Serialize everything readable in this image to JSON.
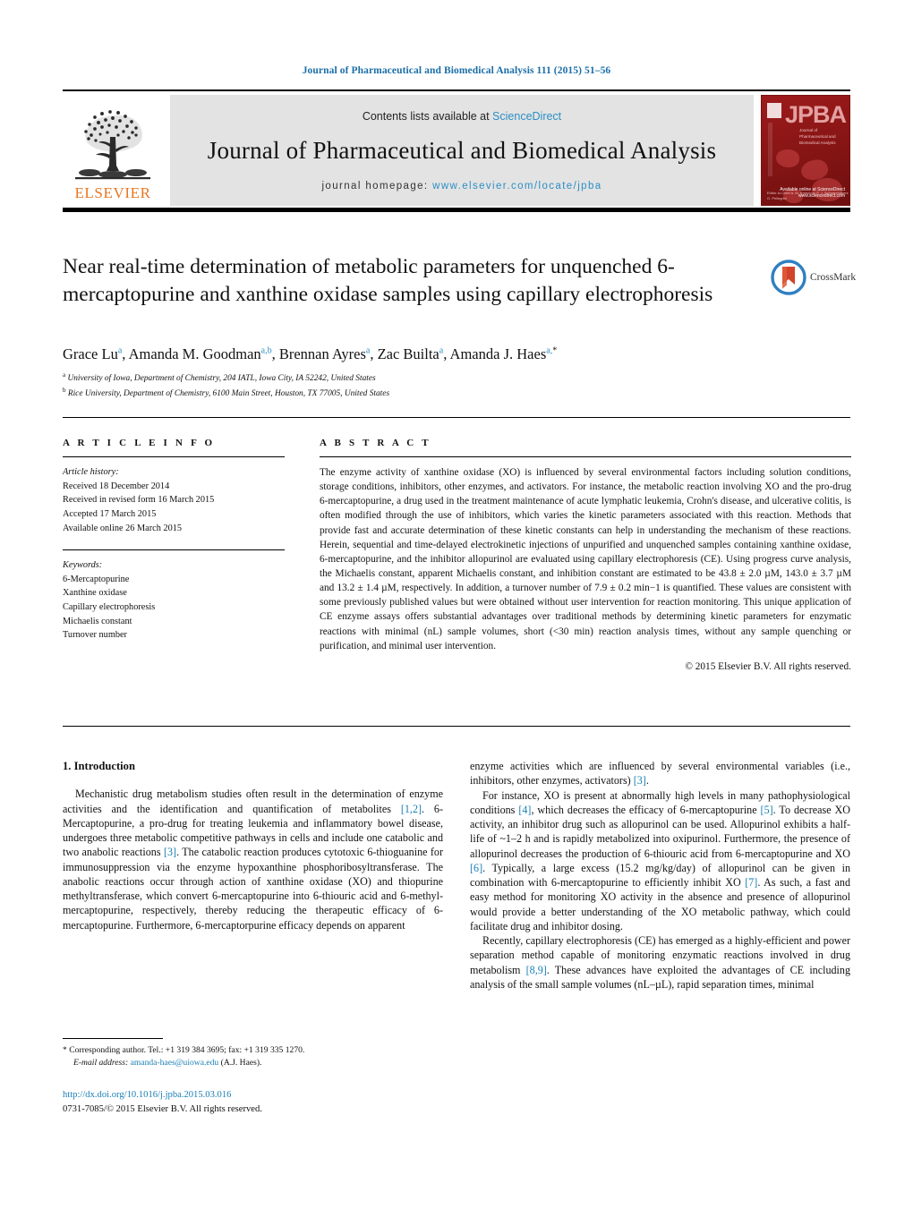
{
  "running_head": "Journal of Pharmaceutical and Biomedical Analysis 111 (2015) 51–56",
  "masthead": {
    "publisher": "ELSEVIER",
    "contents_prefix": "Contents lists available at ",
    "contents_link": "ScienceDirect",
    "journal_title": "Journal of Pharmaceutical and Biomedical Analysis",
    "homepage_prefix": "journal homepage: ",
    "homepage_url": "www.elsevier.com/locate/jpba",
    "cover": {
      "acronym": "JPBA",
      "subtitle": "Journal of Pharmaceutical and Biomedical Analysis",
      "footer": "Editor-in-Chief\nA. M. Krstulovic\nP. J. Schoenmakers\nG. Pellegrini",
      "sciencedirect": "Available online at\nScienceDirect\nwww.sciencedirect.com"
    }
  },
  "article": {
    "title": "Near real-time determination of metabolic parameters for unquenched 6-mercaptopurine and xanthine oxidase samples using capillary electrophoresis",
    "crossmark_label": "CrossMark",
    "authors_html": "Grace Lu<sup>a</sup>, Amanda M. Goodman<sup>a,b</sup>, Brennan Ayres<sup>a</sup>, Zac Builta<sup>a</sup>, Amanda J. Haes<sup>a,</sup><sup class=\"star\">*</sup>",
    "affiliations": [
      "University of Iowa, Department of Chemistry, 204 IATL, Iowa City, IA 52242, United States",
      "Rice University, Department of Chemistry, 6100 Main Street, Houston, TX 77005, United States"
    ],
    "affiliation_marks": [
      "a",
      "b"
    ]
  },
  "article_info": {
    "heading": "A R T I C L E  I N F O",
    "history_label": "Article history:",
    "history": [
      "Received 18 December 2014",
      "Received in revised form 16 March 2015",
      "Accepted 17 March 2015",
      "Available online 26 March 2015"
    ],
    "keywords_label": "Keywords:",
    "keywords": [
      "6-Mercaptopurine",
      "Xanthine oxidase",
      "Capillary electrophoresis",
      "Michaelis constant",
      "Turnover number"
    ]
  },
  "abstract": {
    "heading": "A B S T R A C T",
    "text": "The enzyme activity of xanthine oxidase (XO) is influenced by several environmental factors including solution conditions, storage conditions, inhibitors, other enzymes, and activators. For instance, the metabolic reaction involving XO and the pro-drug 6-mercaptopurine, a drug used in the treatment maintenance of acute lymphatic leukemia, Crohn's disease, and ulcerative colitis, is often modified through the use of inhibitors, which varies the kinetic parameters associated with this reaction. Methods that provide fast and accurate determination of these kinetic constants can help in understanding the mechanism of these reactions. Herein, sequential and time-delayed electrokinetic injections of unpurified and unquenched samples containing xanthine oxidase, 6-mercaptopurine, and the inhibitor allopurinol are evaluated using capillary electrophoresis (CE). Using progress curve analysis, the Michaelis constant, apparent Michaelis constant, and inhibition constant are estimated to be 43.8 ± 2.0 µM, 143.0 ± 3.7 µM and 13.2 ± 1.4 µM, respectively. In addition, a turnover number of 7.9 ± 0.2 min−1 is quantified. These values are consistent with some previously published values but were obtained without user intervention for reaction monitoring. This unique application of CE enzyme assays offers substantial advantages over traditional methods by determining kinetic parameters for enzymatic reactions with minimal (nL) sample volumes, short (<30 min) reaction analysis times, without any sample quenching or purification, and minimal user intervention.",
    "copyright": "© 2015 Elsevier B.V. All rights reserved."
  },
  "body": {
    "section_heading": "1.  Introduction",
    "left_paragraphs": [
      "Mechanistic drug metabolism studies often result in the determination of enzyme activities and the identification and quantification of metabolites [1,2]. 6-Mercaptopurine, a pro-drug for treating leukemia and inflammatory bowel disease, undergoes three metabolic competitive pathways in cells and include one catabolic and two anabolic reactions [3]. The catabolic reaction produces cytotoxic 6-thioguanine for immunosuppression via the enzyme hypoxanthine phosphoribosyltransferase. The anabolic reactions occur through action of xanthine oxidase (XO) and thiopurine methyltransferase, which convert 6-mercaptopurine into 6-thiouric acid and 6-methyl-mercaptopurine, respectively, thereby reducing the therapeutic efficacy of 6-mercaptopurine. Furthermore, 6-mercaptorpurine efficacy depends on apparent"
    ],
    "right_paragraphs": [
      "enzyme activities which are influenced by several environmental variables (i.e., inhibitors, other enzymes, activators) [3].",
      "For instance, XO is present at abnormally high levels in many pathophysiological conditions [4], which decreases the efficacy of 6-mercaptopurine [5]. To decrease XO activity, an inhibitor drug such as allopurinol can be used. Allopurinol exhibits a half-life of ~1–2 h and is rapidly metabolized into oxipurinol. Furthermore, the presence of allopurinol decreases the production of 6-thiouric acid from 6-mercaptopurine and XO [6]. Typically, a large excess (15.2 mg/kg/day) of allopurinol can be given in combination with 6-mercaptopurine to efficiently inhibit XO [7]. As such, a fast and easy method for monitoring XO activity in the absence and presence of allopurinol would provide a better understanding of the XO metabolic pathway, which could facilitate drug and inhibitor dosing.",
      "Recently, capillary electrophoresis (CE) has emerged as a highly-efficient and power separation method capable of monitoring enzymatic reactions involved in drug metabolism [8,9]. These advances have exploited the advantages of CE including analysis of the small sample volumes (nL–µL), rapid separation times, minimal"
    ],
    "citations_left": [
      "[1,2]",
      "[3]"
    ],
    "citations_right": [
      "[3]",
      "[4]",
      "[5]",
      "[6]",
      "[7]",
      "[8,9]"
    ]
  },
  "footer": {
    "corresponding_marker": "*",
    "corresponding_text": "Corresponding author. Tel.: +1 319 384 3695; fax: +1 319 335 1270.",
    "email_label": "E-mail address:",
    "email": "amanda-haes@uiowa.edu",
    "email_suffix": "(A.J. Haes).",
    "doi": "http://dx.doi.org/10.1016/j.jpba.2015.03.016",
    "issn": "0731-7085/© 2015 Elsevier B.V. All rights reserved."
  }
}
